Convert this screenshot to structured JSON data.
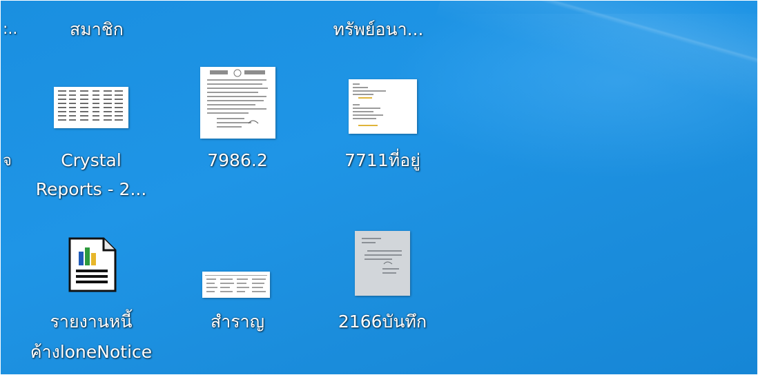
{
  "desktop": {
    "icons": [
      {
        "label_lines": [
          "สมาชิก"
        ],
        "icon": "document-thumbnail-icon"
      },
      {
        "label_lines": [
          "ทรัพย์อนา..."
        ],
        "icon": "document-thumbnail-icon"
      },
      {
        "label_lines": [
          "Crystal",
          "Reports - 2..."
        ],
        "icon": "spreadsheet-thumbnail-icon"
      },
      {
        "label_lines": [
          "7986.2"
        ],
        "icon": "scanned-document-thumbnail-icon"
      },
      {
        "label_lines": [
          "7711ที่อยู่"
        ],
        "icon": "address-document-thumbnail-icon"
      },
      {
        "label_lines": [
          "รายงานหนี้",
          "ค้างloneNotice"
        ],
        "icon": "report-file-icon"
      },
      {
        "label_lines": [
          "สำราญ"
        ],
        "icon": "spreadsheet-thumbnail-icon"
      },
      {
        "label_lines": [
          "2166บันทึก"
        ],
        "icon": "scanned-letter-thumbnail-icon"
      }
    ],
    "partial_left": {
      "top_label": ":..",
      "mid_label": "จ"
    }
  },
  "colors": {
    "desktop_background": "#1a8fe0",
    "label_text": "#ffffff",
    "report_icon_blue": "#1f5bb8",
    "report_icon_green": "#2e9a3e",
    "report_icon_yellow": "#e7b62a"
  }
}
